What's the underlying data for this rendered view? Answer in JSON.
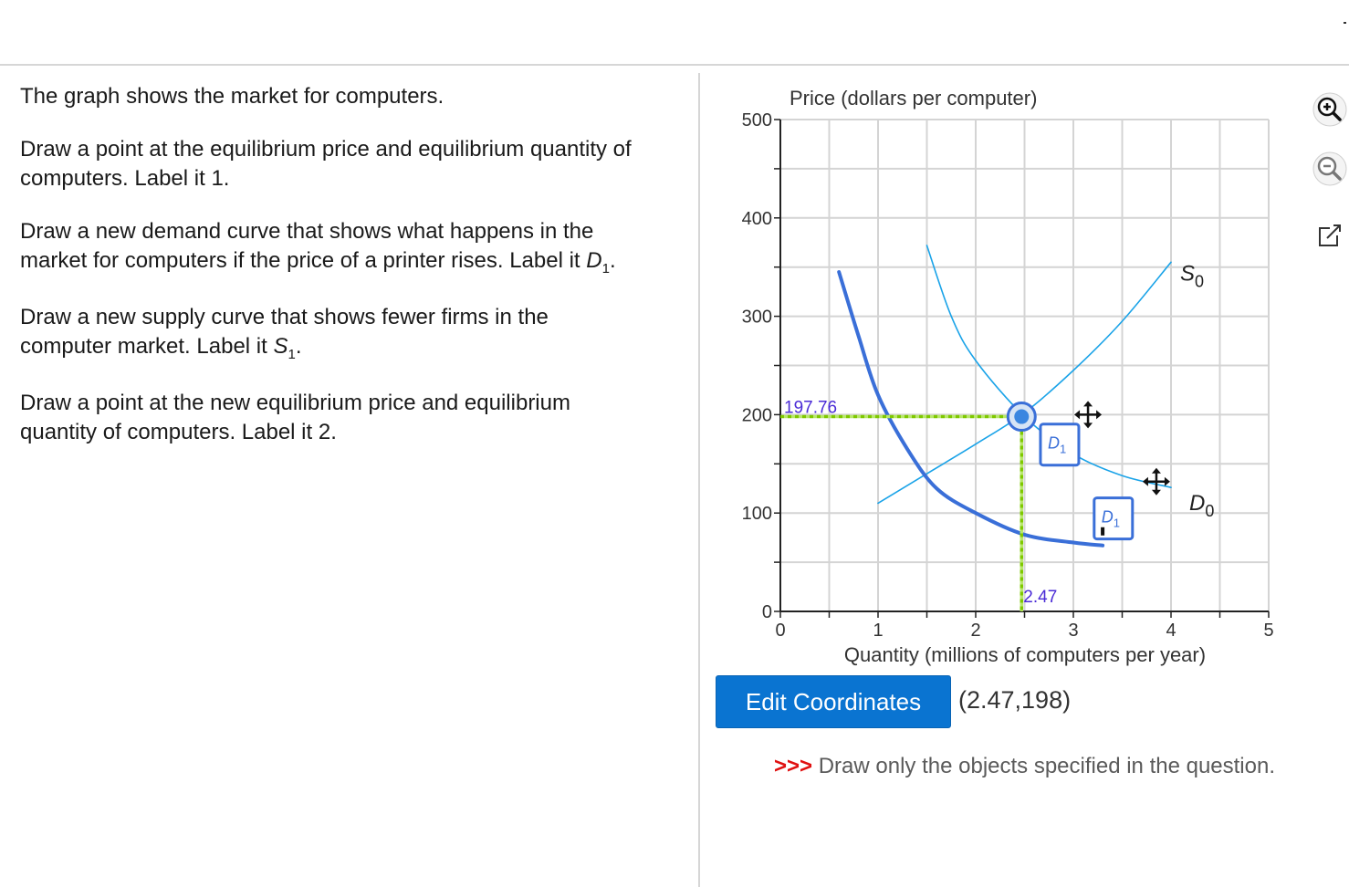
{
  "question": {
    "line1": "The graph shows the market for computers.",
    "line2a": "Draw a point at the equilibrium price and equilibrium quantity of",
    "line2b": "computers. Label it 1.",
    "line3a": "Draw a new demand curve that shows what happens in the",
    "line3b": "market for computers if the price of a printer rises. Label it ",
    "line3_label_letter": "D",
    "line3_label_sub": "1",
    "line3_end": ".",
    "line4a": "Draw a new supply curve that shows fewer firms in the",
    "line4b": "computer market. Label it ",
    "line4_label_letter": "S",
    "line4_label_sub": "1",
    "line4_end": ".",
    "line5a": "Draw a point at the new equilibrium price and equilibrium",
    "line5b": "quantity of computers. Label it 2."
  },
  "chart_data": {
    "type": "line",
    "ylabel": "Price (dollars per computer)",
    "xlabel": "Quantity (millions of computers per year)",
    "xlim": [
      0,
      5
    ],
    "ylim": [
      0,
      500
    ],
    "x_ticks": [
      "0",
      "1",
      "2",
      "3",
      "4",
      "5"
    ],
    "y_ticks": [
      "0",
      "100",
      "200",
      "300",
      "400",
      "500"
    ],
    "grid": true,
    "series": [
      {
        "name": "S0",
        "name_letter": "S",
        "name_sub": "0",
        "color": "#1aa3e8",
        "points": [
          [
            1,
            110
          ],
          [
            1.5,
            140
          ],
          [
            2,
            170
          ],
          [
            2.5,
            202
          ],
          [
            3,
            245
          ],
          [
            3.5,
            295
          ],
          [
            4,
            355
          ]
        ]
      },
      {
        "name": "D0",
        "name_letter": "D",
        "name_sub": "0",
        "color": "#1aa3e8",
        "points": [
          [
            1.5,
            372
          ],
          [
            1.75,
            300
          ],
          [
            2,
            255
          ],
          [
            2.5,
            198
          ],
          [
            3,
            160
          ],
          [
            3.5,
            138
          ],
          [
            4,
            126
          ]
        ]
      },
      {
        "name": "D1",
        "name_letter": "D",
        "name_sub": "1",
        "color": "#3a6fd8",
        "points": [
          [
            0.6,
            345
          ],
          [
            0.8,
            280
          ],
          [
            1,
            220
          ],
          [
            1.3,
            165
          ],
          [
            1.6,
            125
          ],
          [
            2,
            100
          ],
          [
            2.5,
            78
          ],
          [
            3,
            70
          ],
          [
            3.3,
            67
          ]
        ]
      }
    ],
    "equilibrium_point": {
      "x": 2.47,
      "y": 198
    },
    "guide_labels": {
      "x": "2.47",
      "y": "197.76"
    },
    "label_boxes": [
      {
        "letter": "D",
        "sub": "1",
        "x": 2.85,
        "y": 170
      },
      {
        "letter": "D",
        "sub": "1",
        "x": 3.4,
        "y": 95
      }
    ],
    "move_handles": [
      {
        "x": 3.15,
        "y": 200
      },
      {
        "x": 3.85,
        "y": 132
      }
    ]
  },
  "toolbar": {
    "zoom_in_icon": "zoom-in-icon",
    "zoom_out_icon": "zoom-out-icon",
    "popout_icon": "external-link-icon"
  },
  "edit_button_label": "Edit Coordinates",
  "coordinate_readout": "(2.47,198)",
  "instruction": {
    "arrows": ">>>",
    "text": "Draw only the objects specified in the question."
  },
  "colors": {
    "accent": "#0a74d1",
    "guide_line": "#7ec800",
    "guide_label": "#4a2bd6",
    "curve_light": "#1aa3e8",
    "curve_dark": "#3a6fd8"
  }
}
